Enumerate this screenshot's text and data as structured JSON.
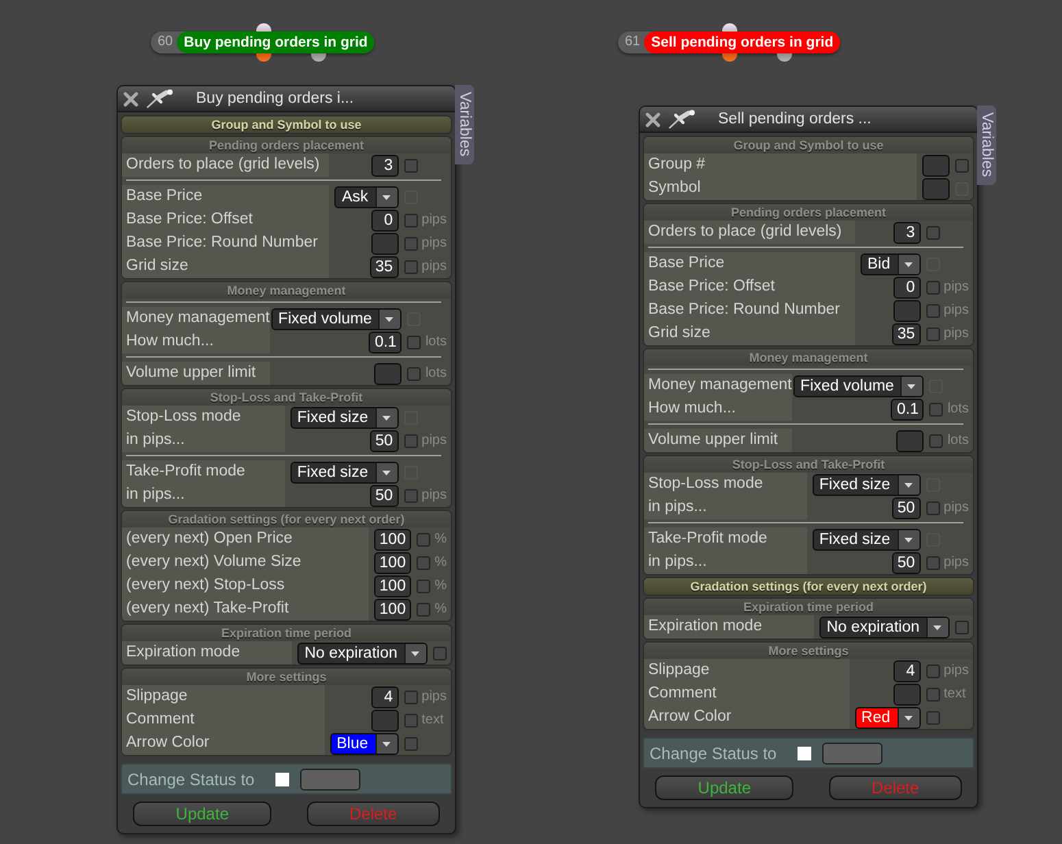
{
  "nodes": [
    {
      "number": "60",
      "title": "Buy pending orders in grid",
      "color": "#008000"
    },
    {
      "number": "61",
      "title": "Sell pending orders in grid",
      "color": "#ff0000"
    }
  ],
  "panels": [
    {
      "title": "Buy pending orders i...",
      "side_tab": "Variables",
      "sections": [
        {
          "title": "Group and Symbol to use",
          "expanded": false
        },
        {
          "title": "Pending orders placement",
          "expanded": true,
          "groups": [
            {
              "rows": [
                {
                  "label": "Orders to place (grid levels)",
                  "kind": "input",
                  "value": "3",
                  "checked": false,
                  "disabled": false
                }
              ]
            },
            {
              "rows": [
                {
                  "label": "Base Price",
                  "kind": "select",
                  "value": "Ask",
                  "checked": false,
                  "disabled": true
                },
                {
                  "label": "Base Price: Offset",
                  "kind": "input",
                  "value": "0",
                  "unit": "pips",
                  "checked": false,
                  "disabled": false
                },
                {
                  "label": "Base Price: Round Number",
                  "kind": "input",
                  "unit": "pips",
                  "checked": false,
                  "disabled": false
                },
                {
                  "label": "Grid size",
                  "kind": "input",
                  "value": "35",
                  "unit": "pips",
                  "checked": false,
                  "disabled": false
                }
              ]
            }
          ]
        },
        {
          "title": "Money management",
          "expanded": true,
          "top_rule": true,
          "groups": [
            {
              "rows": [
                {
                  "label": "Money management",
                  "kind": "select",
                  "value": "Fixed volume",
                  "checked": false,
                  "disabled": true
                },
                {
                  "label": "How much...",
                  "kind": "input",
                  "value": "0.1",
                  "unit": "lots",
                  "checked": false,
                  "disabled": false
                }
              ]
            },
            {
              "rows": [
                {
                  "label": "Volume upper limit",
                  "kind": "input",
                  "unit": "lots",
                  "checked": false,
                  "disabled": false
                }
              ]
            }
          ]
        },
        {
          "title": "Stop-Loss and Take-Profit",
          "expanded": true,
          "groups": [
            {
              "rows": [
                {
                  "label": "Stop-Loss mode",
                  "kind": "select",
                  "value": "Fixed size",
                  "checked": false,
                  "disabled": true
                },
                {
                  "label": "in pips...",
                  "kind": "input",
                  "value": "50",
                  "unit": "pips",
                  "checked": false,
                  "disabled": false
                }
              ]
            },
            {
              "rows": [
                {
                  "label": "Take-Profit mode",
                  "kind": "select",
                  "value": "Fixed size",
                  "checked": false,
                  "disabled": true
                },
                {
                  "label": "in pips...",
                  "kind": "input",
                  "value": "50",
                  "unit": "pips",
                  "checked": false,
                  "disabled": false
                }
              ]
            }
          ]
        },
        {
          "title": "Gradation settings (for every next order)",
          "expanded": true,
          "groups": [
            {
              "rows": [
                {
                  "label": "(every next) Open Price",
                  "kind": "input",
                  "value": "100",
                  "unit": "%",
                  "checked": false,
                  "disabled": false
                },
                {
                  "label": "(every next) Volume Size",
                  "kind": "input",
                  "value": "100",
                  "unit": "%",
                  "checked": false,
                  "disabled": false
                },
                {
                  "label": "(every next) Stop-Loss",
                  "kind": "input",
                  "value": "100",
                  "unit": "%",
                  "checked": false,
                  "disabled": false
                },
                {
                  "label": "(every next) Take-Profit",
                  "kind": "input",
                  "value": "100",
                  "unit": "%",
                  "checked": false,
                  "disabled": false
                }
              ]
            }
          ]
        },
        {
          "title": "Expiration time period",
          "expanded": true,
          "groups": [
            {
              "rows": [
                {
                  "label": "Expiration mode",
                  "kind": "select",
                  "value": "No expiration",
                  "checked": false,
                  "disabled": false
                }
              ]
            }
          ]
        },
        {
          "title": "More settings",
          "expanded": true,
          "groups": [
            {
              "rows": [
                {
                  "label": "Slippage",
                  "kind": "input",
                  "value": "4",
                  "unit": "pips",
                  "checked": false,
                  "disabled": false
                },
                {
                  "label": "Comment",
                  "kind": "input",
                  "unit": "text",
                  "checked": false,
                  "disabled": false
                },
                {
                  "label": "Arrow Color",
                  "kind": "select",
                  "value": "Blue",
                  "color": "#0000ff",
                  "checked": false,
                  "disabled": false
                }
              ]
            }
          ]
        }
      ],
      "status": {
        "label": "Change Status to",
        "checked": false
      },
      "buttons": [
        {
          "label": "Update",
          "kind": "update"
        },
        {
          "label": "Delete",
          "kind": "delete"
        }
      ]
    },
    {
      "title": "Sell pending orders ...",
      "side_tab": "Variables",
      "sections": [
        {
          "title": "Group and Symbol to use",
          "expanded": true,
          "groups": [
            {
              "rows": [
                {
                  "label": "Group #",
                  "kind": "input",
                  "checked": false,
                  "disabled": false
                },
                {
                  "label": "Symbol",
                  "kind": "input",
                  "checked": false,
                  "disabled": true
                }
              ]
            }
          ]
        },
        {
          "title": "Pending orders placement",
          "expanded": true,
          "groups": [
            {
              "rows": [
                {
                  "label": "Orders to place (grid levels)",
                  "kind": "input",
                  "value": "3",
                  "checked": false,
                  "disabled": false
                }
              ]
            },
            {
              "rows": [
                {
                  "label": "Base Price",
                  "kind": "select",
                  "value": "Bid",
                  "checked": false,
                  "disabled": true
                },
                {
                  "label": "Base Price: Offset",
                  "kind": "input",
                  "value": "0",
                  "unit": "pips",
                  "checked": false,
                  "disabled": false
                },
                {
                  "label": "Base Price: Round Number",
                  "kind": "input",
                  "unit": "pips",
                  "checked": false,
                  "disabled": false
                },
                {
                  "label": "Grid size",
                  "kind": "input",
                  "value": "35",
                  "unit": "pips",
                  "checked": false,
                  "disabled": false
                }
              ]
            }
          ]
        },
        {
          "title": "Money management",
          "expanded": true,
          "top_rule": true,
          "groups": [
            {
              "rows": [
                {
                  "label": "Money management",
                  "kind": "select",
                  "value": "Fixed volume",
                  "checked": false,
                  "disabled": true
                },
                {
                  "label": "How much...",
                  "kind": "input",
                  "value": "0.1",
                  "unit": "lots",
                  "checked": false,
                  "disabled": false
                }
              ]
            },
            {
              "rows": [
                {
                  "label": "Volume upper limit",
                  "kind": "input",
                  "unit": "lots",
                  "checked": false,
                  "disabled": false
                }
              ]
            }
          ]
        },
        {
          "title": "Stop-Loss and Take-Profit",
          "expanded": true,
          "groups": [
            {
              "rows": [
                {
                  "label": "Stop-Loss mode",
                  "kind": "select",
                  "value": "Fixed size",
                  "checked": false,
                  "disabled": true
                },
                {
                  "label": "in pips...",
                  "kind": "input",
                  "value": "50",
                  "unit": "pips",
                  "checked": false,
                  "disabled": false
                }
              ]
            },
            {
              "rows": [
                {
                  "label": "Take-Profit mode",
                  "kind": "select",
                  "value": "Fixed size",
                  "checked": false,
                  "disabled": true
                },
                {
                  "label": "in pips...",
                  "kind": "input",
                  "value": "50",
                  "unit": "pips",
                  "checked": false,
                  "disabled": false
                }
              ]
            }
          ]
        },
        {
          "title": "Gradation settings (for every next order)",
          "expanded": false
        },
        {
          "title": "Expiration time period",
          "expanded": true,
          "groups": [
            {
              "rows": [
                {
                  "label": "Expiration mode",
                  "kind": "select",
                  "value": "No expiration",
                  "checked": false,
                  "disabled": false
                }
              ]
            }
          ]
        },
        {
          "title": "More settings",
          "expanded": true,
          "groups": [
            {
              "rows": [
                {
                  "label": "Slippage",
                  "kind": "input",
                  "value": "4",
                  "unit": "pips",
                  "checked": false,
                  "disabled": false
                },
                {
                  "label": "Comment",
                  "kind": "input",
                  "unit": "text",
                  "checked": false,
                  "disabled": false
                },
                {
                  "label": "Arrow Color",
                  "kind": "select",
                  "value": "Red",
                  "color": "#ff0000",
                  "checked": false,
                  "disabled": false
                }
              ]
            }
          ]
        }
      ],
      "status": {
        "label": "Change Status to",
        "checked": false
      },
      "buttons": [
        {
          "label": "Update",
          "kind": "update"
        },
        {
          "label": "Delete",
          "kind": "delete"
        }
      ]
    }
  ]
}
